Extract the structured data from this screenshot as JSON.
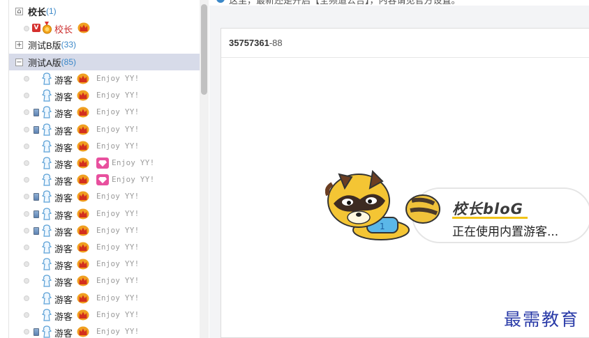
{
  "notice_text": "这里，最新还是开启【全频道公告】，内容请见官方设置。",
  "groups": [
    {
      "name": "校长",
      "count": "(1)"
    },
    {
      "name": "测试B版",
      "count": "(33)"
    },
    {
      "name": "测试A版",
      "count": "(85)"
    }
  ],
  "admin": {
    "badge": "V",
    "name": "校长"
  },
  "members": [
    {
      "name": "游客",
      "signature": "Enjoy YY!",
      "phone": false,
      "diamond": false
    },
    {
      "name": "游客",
      "signature": "Enjoy YY!",
      "phone": false,
      "diamond": false
    },
    {
      "name": "游客",
      "signature": "Enjoy YY!",
      "phone": true,
      "diamond": false
    },
    {
      "name": "游客",
      "signature": "Enjoy YY!",
      "phone": true,
      "diamond": false
    },
    {
      "name": "游客",
      "signature": "Enjoy YY!",
      "phone": false,
      "diamond": false
    },
    {
      "name": "游客",
      "signature": "Enjoy YY!",
      "phone": false,
      "diamond": true
    },
    {
      "name": "游客",
      "signature": "Enjoy YY!",
      "phone": false,
      "diamond": true
    },
    {
      "name": "游客",
      "signature": "Enjoy YY!",
      "phone": true,
      "diamond": false
    },
    {
      "name": "游客",
      "signature": "Enjoy YY!",
      "phone": true,
      "diamond": false
    },
    {
      "name": "游客",
      "signature": "Enjoy YY!",
      "phone": true,
      "diamond": false
    },
    {
      "name": "游客",
      "signature": "Enjoy YY!",
      "phone": false,
      "diamond": false
    },
    {
      "name": "游客",
      "signature": "Enjoy YY!",
      "phone": false,
      "diamond": false
    },
    {
      "name": "游客",
      "signature": "Enjoy YY!",
      "phone": false,
      "diamond": false
    },
    {
      "name": "游客",
      "signature": "Enjoy YY!",
      "phone": false,
      "diamond": false
    },
    {
      "name": "游客",
      "signature": "Enjoy YY!",
      "phone": false,
      "diamond": false
    },
    {
      "name": "游客",
      "signature": "Enjoy YY!",
      "phone": true,
      "diamond": false
    }
  ],
  "room": {
    "id": "35757361",
    "sub": "-88"
  },
  "banner": {
    "title": "校长bloG",
    "subtitle": "正在使用内置游客..."
  },
  "watermark": "最需教育",
  "colors": {
    "accent": "#3a87c8",
    "selected_row": "#d7dbe9",
    "admin_red": "#cc2e2e",
    "crown": "#f0a020",
    "diamond": "#e8509e",
    "watermark": "#2a3ba8"
  }
}
